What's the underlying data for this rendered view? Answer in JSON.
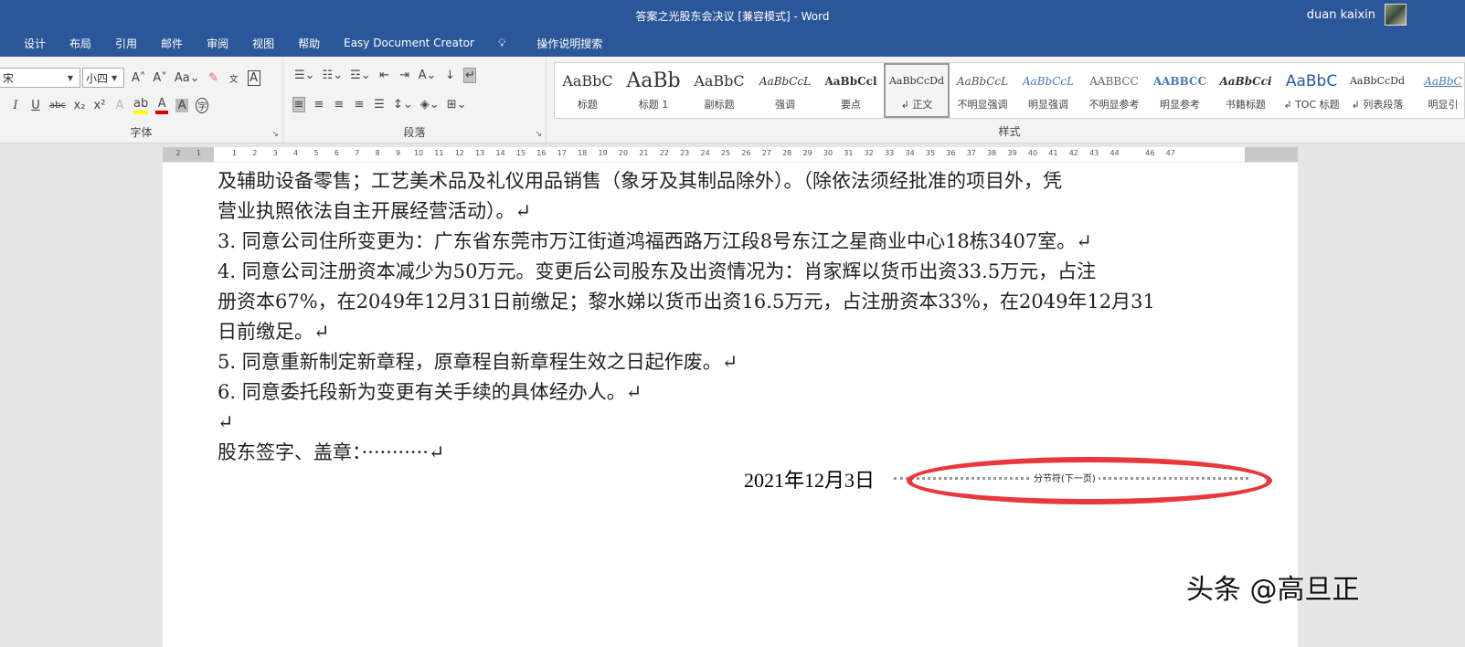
{
  "titlebar": {
    "title": "答案之光股东会决议 [兼容模式]  -  Word",
    "user": "duan kaixin"
  },
  "tabs": [
    "设计",
    "布局",
    "引用",
    "邮件",
    "审阅",
    "视图",
    "帮助",
    "Easy Document Creator"
  ],
  "tell_me": "操作说明搜索",
  "font": {
    "name": "宋",
    "size": "小四",
    "group_label": "字体"
  },
  "paragraph": {
    "group_label": "段落"
  },
  "styles": {
    "group_label": "样式",
    "items": [
      {
        "preview": "AaBbC",
        "name": "标题"
      },
      {
        "preview": "AaBb",
        "name": "标题 1"
      },
      {
        "preview": "AaBbC",
        "name": "副标题"
      },
      {
        "preview": "AaBbCcL",
        "name": "强调"
      },
      {
        "preview": "AaBbCcl",
        "name": "要点"
      },
      {
        "preview": "AaBbCcDd",
        "name": "↲ 正文"
      },
      {
        "preview": "AaBbCcL",
        "name": "不明显强调"
      },
      {
        "preview": "AaBbCcL",
        "name": "明显强调"
      },
      {
        "preview": "AABBCC",
        "name": "不明显参考"
      },
      {
        "preview": "AABBCC",
        "name": "明显参考"
      },
      {
        "preview": "AaBbCci",
        "name": "书籍标题"
      },
      {
        "preview": "AaBbC",
        "name": "↲ TOC 标题"
      },
      {
        "preview": "AaBbCcDd",
        "name": "↲ 列表段落"
      },
      {
        "preview": "AaBbC",
        "name": "明显引"
      }
    ]
  },
  "document": {
    "lines": [
      "及辅助设备零售；工艺美术品及礼仪用品销售（象牙及其制品除外）。（除依法须经批准的项目外，凭",
      "营业执照依法自主开展经营活动）。↵",
      "3. 同意公司住所变更为：广东省东莞市万江街道鸿福西路万江段8号东江之星商业中心18栋3407室。↵",
      "4. 同意公司注册资本减少为50万元。变更后公司股东及出资情况为：肖家辉以货币出资33.5万元，占注",
      "册资本67%，在2049年12月31日前缴足；黎水娣以货币出资16.5万元，占注册资本33%，在2049年12月31",
      "日前缴足。↵",
      "5. 同意重新制定新章程，原章程自新章程生效之日起作废。↵",
      "6. 同意委托段新为变更有关手续的具体经办人。↵",
      "↵",
      "股东签字、盖章：···········↵"
    ],
    "date": "2021年12月3日",
    "section_break": "分节符(下一页)"
  },
  "watermark": "头条 @高旦正",
  "colors": {
    "accent": "#2b579a",
    "annotation": "#e8383d"
  }
}
